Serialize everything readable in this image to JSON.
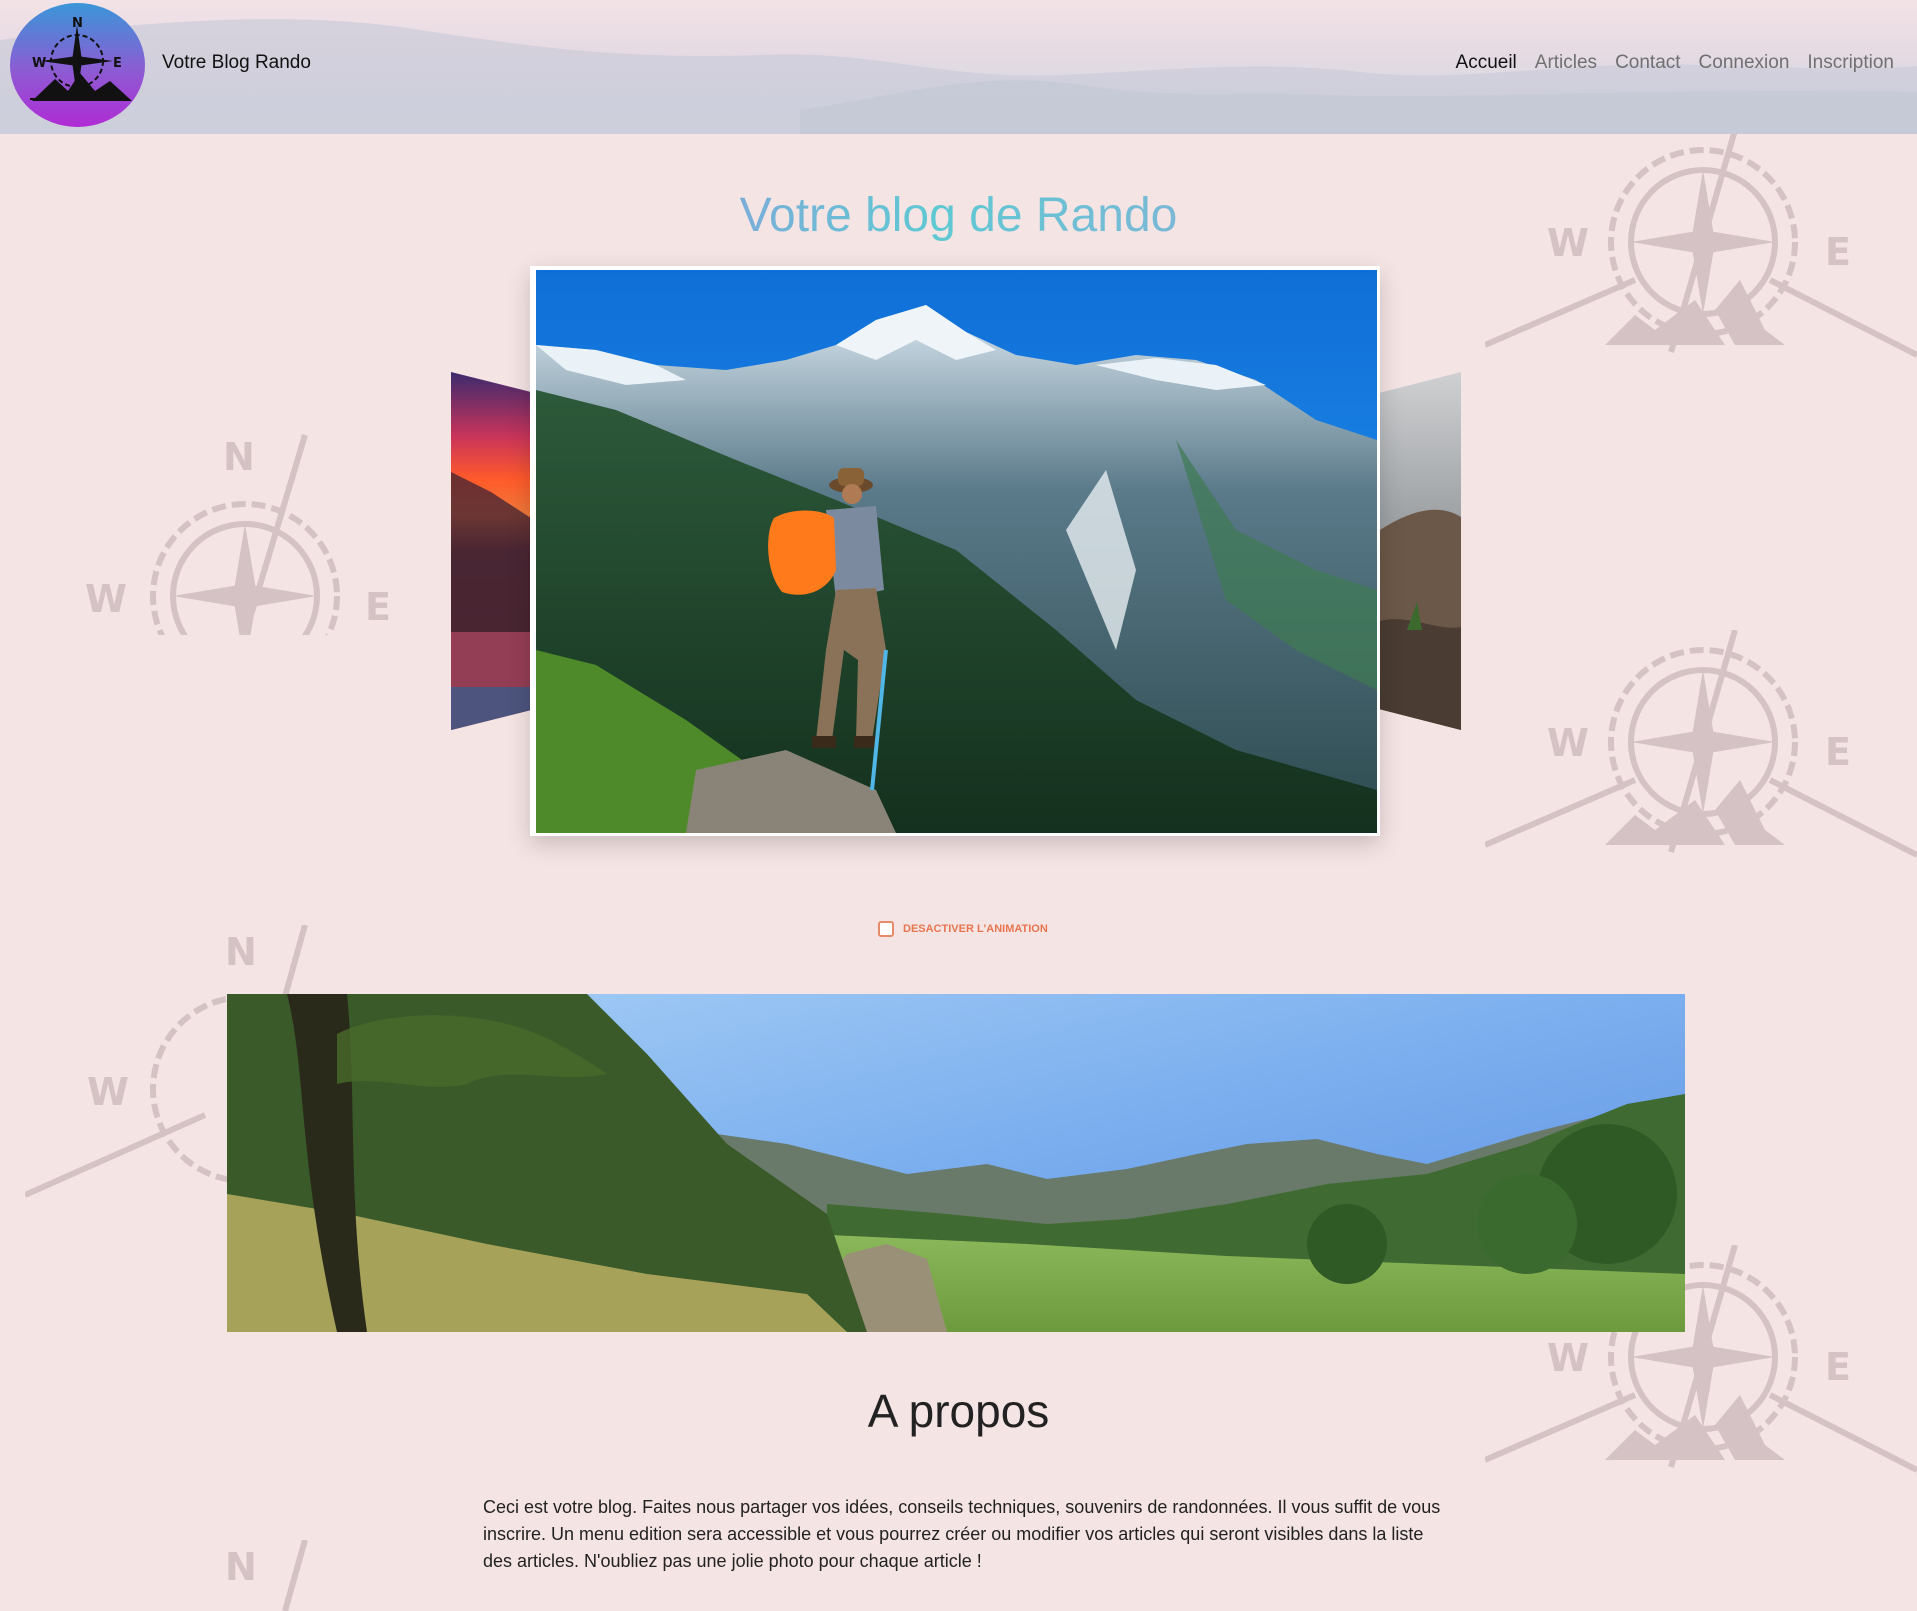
{
  "header": {
    "brand": "Votre Blog Rando",
    "logo_letters": {
      "n": "N",
      "w": "W",
      "e": "E"
    },
    "nav": [
      {
        "label": "Accueil",
        "active": true
      },
      {
        "label": "Articles",
        "active": false
      },
      {
        "label": "Contact",
        "active": false
      },
      {
        "label": "Connexion",
        "active": false
      },
      {
        "label": "Inscription",
        "active": false
      }
    ]
  },
  "hero": {
    "title": "Votre blog de Rando"
  },
  "carousel": {
    "animation_toggle_label": "DESACTIVER L'ANIMATION",
    "animation_disabled": false
  },
  "about": {
    "title": "A propos",
    "text": "Ceci est votre blog. Faites nous partager vos idées, conseils techniques, souvenirs de randonnées. Il vous suffit de vous inscrire. Un menu edition sera accessible et vous pourrez créer ou modifier vos articles qui seront visibles dans la liste des articles. N'oubliez pas une jolie photo pour chaque article !"
  },
  "decor": {
    "compass_letters": {
      "n": "N",
      "w": "W",
      "e": "E"
    }
  },
  "colors": {
    "page_bg": "#f5e4e4",
    "title_gradient_start": "#7aaed8",
    "title_gradient_mid": "#5fc9d3",
    "toggle_accent": "#e7764f",
    "logo_gradient_top": "#3a96d8",
    "logo_gradient_bottom": "#b02bd4"
  },
  "icons": [
    "compass-rose-logo-icon",
    "compass-watermark-icon",
    "checkbox-icon"
  ]
}
